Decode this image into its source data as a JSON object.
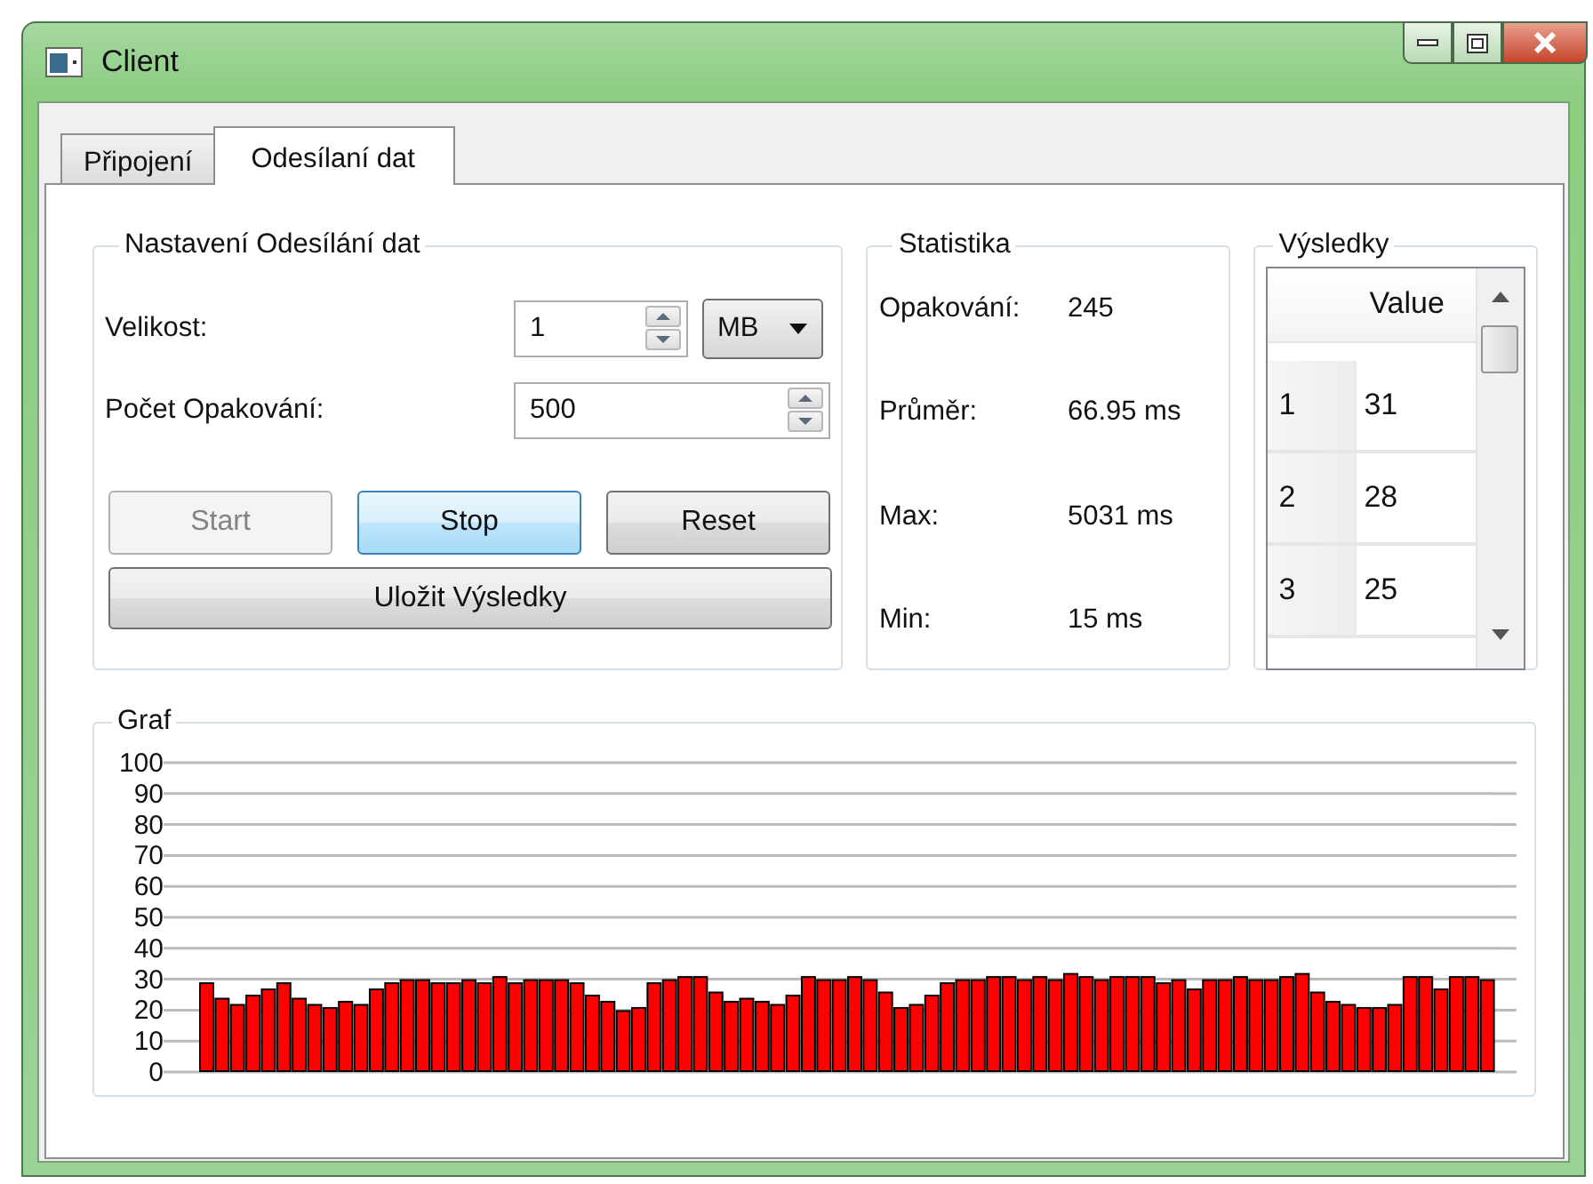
{
  "window": {
    "title": "Client"
  },
  "tabs": [
    {
      "label": "Připojení",
      "selected": false
    },
    {
      "label": "Odesílaní dat",
      "selected": true
    }
  ],
  "settings": {
    "title": "Nastavení Odesílání dat",
    "fields": [
      {
        "label": "Velikost:",
        "value": "1",
        "unit": "MB"
      },
      {
        "label": "Počet Opakování:",
        "value": "500"
      }
    ],
    "buttons": [
      {
        "label": "Start",
        "disabled": true,
        "highlighted": false
      },
      {
        "label": "Stop",
        "disabled": false,
        "highlighted": true
      },
      {
        "label": "Reset",
        "disabled": false,
        "highlighted": false
      }
    ],
    "save_button": {
      "label": "Uložit Výsledky"
    }
  },
  "statistics": {
    "title": "Statistika",
    "rows": [
      {
        "label": "Opakování:",
        "value": "245"
      },
      {
        "label": "Průměr:",
        "value": "66.95 ms"
      },
      {
        "label": "Max:",
        "value": "5031 ms"
      },
      {
        "label": "Min:",
        "value": "15 ms"
      }
    ]
  },
  "results": {
    "title": "Výsledky",
    "columns": [
      "Value"
    ],
    "rows": [
      {
        "index": "1",
        "value": "31"
      },
      {
        "index": "2",
        "value": "28"
      },
      {
        "index": "3",
        "value": "25"
      }
    ]
  },
  "graph": {
    "title": "Graf",
    "chart_data": {
      "type": "bar",
      "grid": true,
      "ylim": [
        0,
        100
      ],
      "yticks": [
        0,
        10,
        20,
        30,
        40,
        50,
        60,
        70,
        80,
        90,
        100
      ],
      "values": [
        29,
        24,
        22,
        25,
        27,
        29,
        24,
        22,
        21,
        23,
        22,
        27,
        29,
        30,
        30,
        29,
        29,
        30,
        29,
        31,
        29,
        30,
        30,
        30,
        29,
        25,
        23,
        20,
        21,
        29,
        30,
        31,
        31,
        26,
        23,
        24,
        23,
        22,
        25,
        31,
        30,
        30,
        31,
        30,
        26,
        21,
        22,
        25,
        29,
        30,
        30,
        31,
        31,
        30,
        31,
        30,
        32,
        31,
        30,
        31,
        31,
        31,
        29,
        30,
        27,
        30,
        30,
        31,
        30,
        30,
        31,
        32,
        26,
        23,
        22,
        21,
        21,
        22,
        31,
        31,
        27,
        31,
        31,
        30
      ]
    }
  }
}
